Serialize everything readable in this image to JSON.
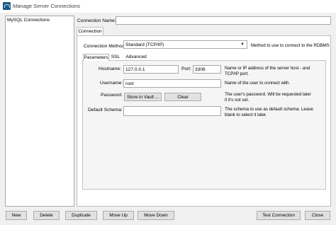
{
  "window": {
    "title": "Manage Server Connections"
  },
  "sidebar": {
    "items": [
      "MySQL Connections"
    ]
  },
  "connection_name": {
    "label": "Connection Name:",
    "value": ""
  },
  "tabs": {
    "connection": "Connection"
  },
  "connection_method": {
    "label": "Connection Method:",
    "value": "Standard (TCP/IP)",
    "description": "Method to use to connect to the RDBMS"
  },
  "subtabs": {
    "parameters": "Parameters",
    "ssl": "SSL",
    "advanced": "Advanced"
  },
  "hostname": {
    "label": "Hostname:",
    "value": "127.0.0.1",
    "description": "Name or IP address of the server host - and TCP/IP port."
  },
  "port": {
    "label": "Port:",
    "value": "3306"
  },
  "username": {
    "label": "Username:",
    "value": "root",
    "description": "Name of the user to connect with."
  },
  "password": {
    "label": "Password:",
    "store_button": "Store in Vault ...",
    "clear_button": "Clear",
    "description": "The user's password. Will be requested later if it's not set."
  },
  "default_schema": {
    "label": "Default Schema:",
    "value": "",
    "description": "The schema to use as default schema. Leave blank to select it later."
  },
  "buttons": {
    "new": "New",
    "delete": "Delete",
    "duplicate": "Duplicate",
    "move_up": "Move Up",
    "move_down": "Move Down",
    "test_connection": "Test Connection",
    "close": "Close"
  }
}
